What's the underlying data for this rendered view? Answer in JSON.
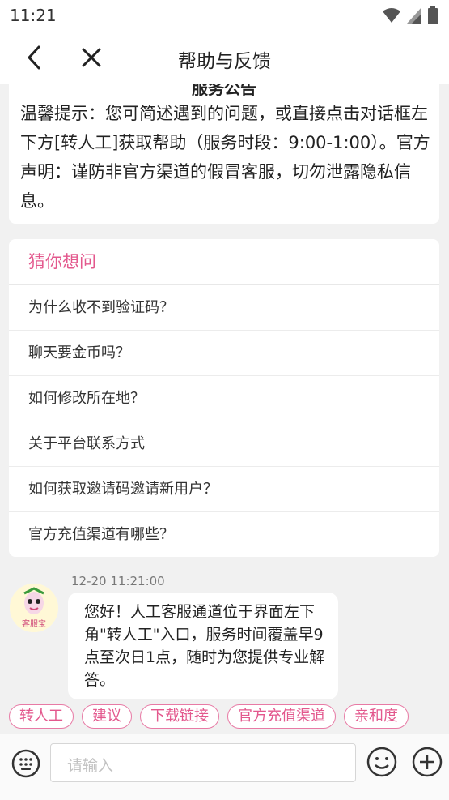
{
  "status_bar": {
    "time": "11:21",
    "icons": [
      "wifi-icon",
      "signal-icon",
      "battery-icon"
    ]
  },
  "header": {
    "title": "帮助与反馈",
    "back_icon": "back-arrow-icon",
    "close_icon": "close-icon"
  },
  "notice": {
    "title": "服务公告",
    "text": "温馨提示：您可简述遇到的问题，或直接点击对话框左下方[转人工]获取帮助（服务时段：9:00-1:00）。官方声明：谨防非官方渠道的假冒客服，切勿泄露隐私信息。"
  },
  "faq": {
    "title": "猜你想问",
    "items": [
      "为什么收不到验证码？",
      "聊天要金币吗？",
      "如何修改所在地？",
      "关于平台联系方式",
      "如何获取邀请码邀请新用户？",
      "官方充值渠道有哪些？"
    ]
  },
  "chat": {
    "timestamp": "12-20 11:21:00",
    "avatar_label": "客服宝",
    "message": "您好！人工客服通道位于界面左下角\"转人工\"入口，服务时间覆盖早9点至次日1点，随时为您提供专业解答。"
  },
  "quick_replies": [
    "转人工",
    "建议",
    "下载链接",
    "官方充值渠道",
    "亲和度"
  ],
  "input_bar": {
    "placeholder": "请输入",
    "keyboard_icon": "keyboard-icon",
    "emoji_icon": "emoji-icon",
    "plus_icon": "plus-icon"
  },
  "colors": {
    "accent": "#e3588d",
    "background": "#f1f1f1"
  }
}
